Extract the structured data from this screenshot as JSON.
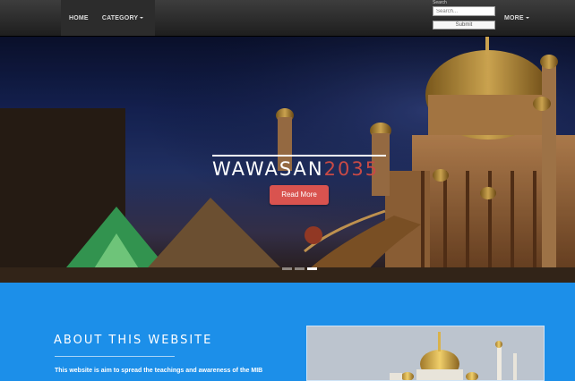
{
  "navbar": {
    "home_label": "HOME",
    "category_label": "CATEGORY",
    "search_label": "Search",
    "search_placeholder": "Search...",
    "submit_label": "Submit",
    "more_label": "MORE"
  },
  "hero": {
    "title_main": "WAWASAN",
    "title_accent": "2035",
    "button_label": "Read More",
    "slide_count": 3,
    "active_slide": 3,
    "colors": {
      "accent": "#d9534f",
      "accent_text": "#c94a45"
    }
  },
  "about": {
    "title": "ABOUT THIS WEBSITE",
    "text": "This website is aim to spread the teachings and awareness of the MIB"
  },
  "colors": {
    "section_bg": "#1c8fe9",
    "navbar_bg": "#2c2c2c"
  }
}
